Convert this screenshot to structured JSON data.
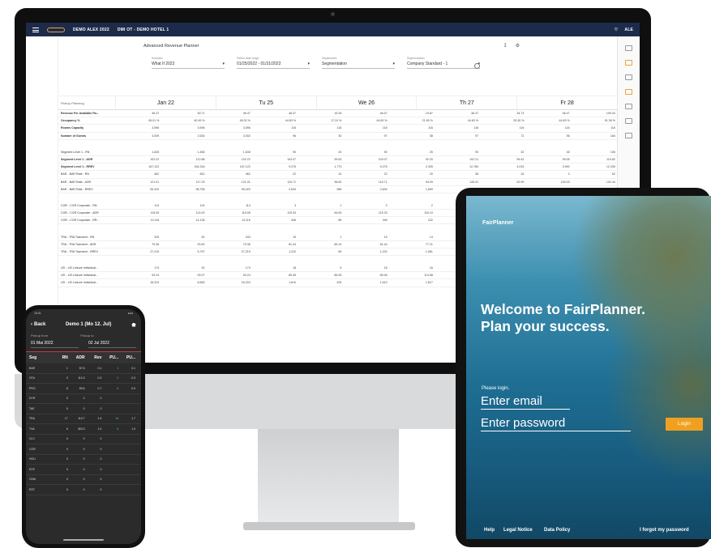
{
  "desktop": {
    "top_bar": {
      "account": "DEMO ALEX 2022",
      "hotel": "DMI OT - DEMO HOTEL 1",
      "user_initials": "ALE"
    },
    "page_title": "Advanced Revenue Planner",
    "filters": [
      {
        "label": "Scenario",
        "value": "What If 2022"
      },
      {
        "label": "Select date range",
        "value": "01/25/2022 - 01/31/2022"
      },
      {
        "label": "Department",
        "value": "Segmentation"
      },
      {
        "label": "Segmentation",
        "value": "Company Standard - 1"
      }
    ],
    "row_header": "Pickup Planning",
    "days": [
      "Jan 22",
      "Tu 25",
      "We 26",
      "Th 27",
      "Fr 28"
    ],
    "rows": [
      {
        "label": "Revenue Per Available Ro...",
        "bold": true,
        "values": [
          "46.47",
          "45.71",
          "46.47",
          "46.47",
          "15.26",
          "46.47",
          "19.87",
          "46.47",
          "34.73",
          "46.47",
          "109.34"
        ]
      },
      {
        "label": "Occupancy %",
        "bold": true,
        "values": [
          "45.01 %",
          "40.49 %",
          "45.02 %",
          "44.83 %",
          "17.24 %",
          "44.83 %",
          "21.55 %",
          "44.83 %",
          "25.35 %",
          "44.83 %",
          "91.38 %"
        ]
      },
      {
        "label": "Rooms Capacity",
        "bold": true,
        "values": [
          "3,596",
          "3,596",
          "3,596",
          "116",
          "116",
          "116",
          "116",
          "116",
          "116",
          "116",
          "116"
        ]
      },
      {
        "label": "Number of Guests",
        "bold": true,
        "values": [
          "3,009",
          "2,634",
          "3,002",
          "96",
          "30",
          "97",
          "38",
          "97",
          "72",
          "96",
          "184"
        ]
      },
      {
        "gap": true
      },
      {
        "label": "Segment Level 1 - RN",
        "values": [
          "1,635",
          "1,456",
          "1,635",
          "90",
          "20",
          "90",
          "25",
          "90",
          "32",
          "45",
          "106"
        ]
      },
      {
        "label": "Segment Level 1 - ADR",
        "bold": true,
        "values": [
          "102.22",
          "112.88",
          "102.22",
          "103.07",
          "99.63",
          "103.07",
          "92.20",
          "102.21",
          "99.42",
          "99.05",
          "110.82"
        ]
      },
      {
        "label": "Segment Level 1 - RREV",
        "bold": true,
        "values": [
          "167,122",
          "164,318",
          "167,122",
          "9,276",
          "1,773",
          "9,276",
          "2,305",
          "12,784",
          "4,015",
          "3,990",
          "12,335"
        ]
      },
      {
        "label": "BAR - BAR Rate - RN",
        "values": [
          "462",
          "842",
          "462",
          "22",
          "10",
          "22",
          "20",
          "36",
          "16",
          "3",
          "62"
        ]
      },
      {
        "label": "BAR - BAR Rate - ADR",
        "values": [
          "121.01",
          "117.29",
          "121.01",
          "115.71",
          "96.62",
          "115.71",
          "94.93",
          "126.91",
          "92.99",
          "100.03",
          "102.44"
        ]
      },
      {
        "label": "BAR - BAR Rate - RREV",
        "values": [
          "55,320",
          "98,758",
          "55,320",
          "2,634",
          "966",
          "2,634",
          "1,899",
          "4,569",
          "1,205",
          "1,300",
          "5,985"
        ]
      },
      {
        "gap": true
      },
      {
        "label": "COR - COR Corporate - RN",
        "values": [
          "114",
          "124",
          "114",
          "3",
          "1",
          "3",
          "2",
          "2",
          "",
          "",
          ""
        ]
      },
      {
        "label": "COR - COR Corporate - ADR",
        "values": [
          "115.05",
          "114.00",
          "115.05",
          "115.33",
          "84.63",
          "115.33",
          "116.10",
          "116.10",
          "",
          "",
          ""
        ]
      },
      {
        "label": "COR - COR Corporate - RR...",
        "values": [
          "13,116",
          "14,136",
          "13,116",
          "346",
          "85",
          "346",
          "232",
          "232",
          "",
          "",
          ""
        ]
      },
      {
        "gap": true
      },
      {
        "label": "TRA - TRA Transient - RN",
        "values": [
          "343",
          "62",
          "343",
          "15",
          "1",
          "15",
          "14",
          "14",
          "",
          "",
          ""
        ]
      },
      {
        "label": "TRA - TRA Transient - ADR",
        "values": [
          "79.36",
          "93.50",
          "79.36",
          "81.44",
          "89.14",
          "81.44",
          "77.21",
          "77.21",
          "",
          "",
          ""
        ]
      },
      {
        "label": "TRA - TRA Transient - RREV",
        "values": [
          "27,219",
          "5,797",
          "27,219",
          "1,222",
          "89",
          "1,222",
          "1,081",
          "1,081",
          "",
          "",
          ""
        ]
      },
      {
        "gap": true
      },
      {
        "label": "LEI - LEI Leisure Individual...",
        "values": [
          "174",
          "92",
          "174",
          "18",
          "5",
          "18",
          "16",
          "16",
          "",
          "",
          ""
        ]
      },
      {
        "label": "LEI - LEI Leisure Individual...",
        "values": [
          "93.24",
          "93.07",
          "93.24",
          "89.45",
          "85.05",
          "89.45",
          "113.58",
          "113.58",
          "",
          "",
          ""
        ]
      },
      {
        "label": "LEI - LEI Leisure Individual...",
        "values": [
          "16,224",
          "8,563",
          "16,224",
          "1,610",
          "425",
          "1,610",
          "1,817",
          "1,817",
          "",
          "",
          ""
        ]
      }
    ]
  },
  "phone": {
    "time": "16:01",
    "back_label": "Back",
    "title": "Demo 1 (Mo 12. Jul)",
    "pickup_from_label": "Pickup from",
    "pickup_to_label": "Pickup to",
    "pickup_from": "01 Mai 2022",
    "pickup_to": "02 Jul 2022",
    "columns": [
      "Seg",
      "RN",
      "ADR",
      "Rev",
      "PU...",
      "PU..."
    ],
    "rows": [
      [
        "BAR",
        "1",
        "87.6",
        "0.1",
        "1",
        "0.1"
      ],
      [
        "OTA",
        "3",
        "110.3",
        "0.3",
        "3",
        "0.3"
      ],
      [
        "PRO",
        "8",
        "89.6",
        "0.7",
        "8",
        "0.9"
      ],
      [
        "DYR",
        "0",
        "0",
        "0",
        "",
        ""
      ],
      [
        "TAE",
        "0",
        "0",
        "0",
        "",
        ""
      ],
      [
        "TRA",
        "17",
        "110.7",
        "1.9",
        "16",
        "1.7"
      ],
      [
        "TVA",
        "6",
        "363.3",
        "1.0",
        "6",
        "1.0"
      ],
      [
        "CLC",
        "0",
        "0",
        "0",
        "",
        ""
      ],
      [
        "COR",
        "0",
        "0",
        "0",
        "",
        ""
      ],
      [
        "HOLI",
        "0",
        "0",
        "0",
        "",
        ""
      ],
      [
        "DTE",
        "0",
        "0",
        "0",
        "",
        ""
      ],
      [
        "CDM",
        "0",
        "0",
        "0",
        "",
        ""
      ],
      [
        "RST",
        "0",
        "0",
        "0",
        "",
        ""
      ]
    ]
  },
  "tablet": {
    "brand": "FairPlanner",
    "welcome_line1": "Welcome to FairPlanner.",
    "welcome_line2": "Plan your success.",
    "please_login": "Please login.",
    "email_placeholder": "Enter email",
    "password_placeholder": "Enter password",
    "login_label": "Login",
    "footer": {
      "help": "Help",
      "legal": "Legal Notice",
      "privacy": "Data Policy",
      "forgot": "I forgot my password"
    }
  },
  "colors": {
    "navy": "#1d2b4a",
    "accent_orange": "#f0a020",
    "positive_green": "#2e9e5b",
    "negative_red": "#c23a3a"
  }
}
